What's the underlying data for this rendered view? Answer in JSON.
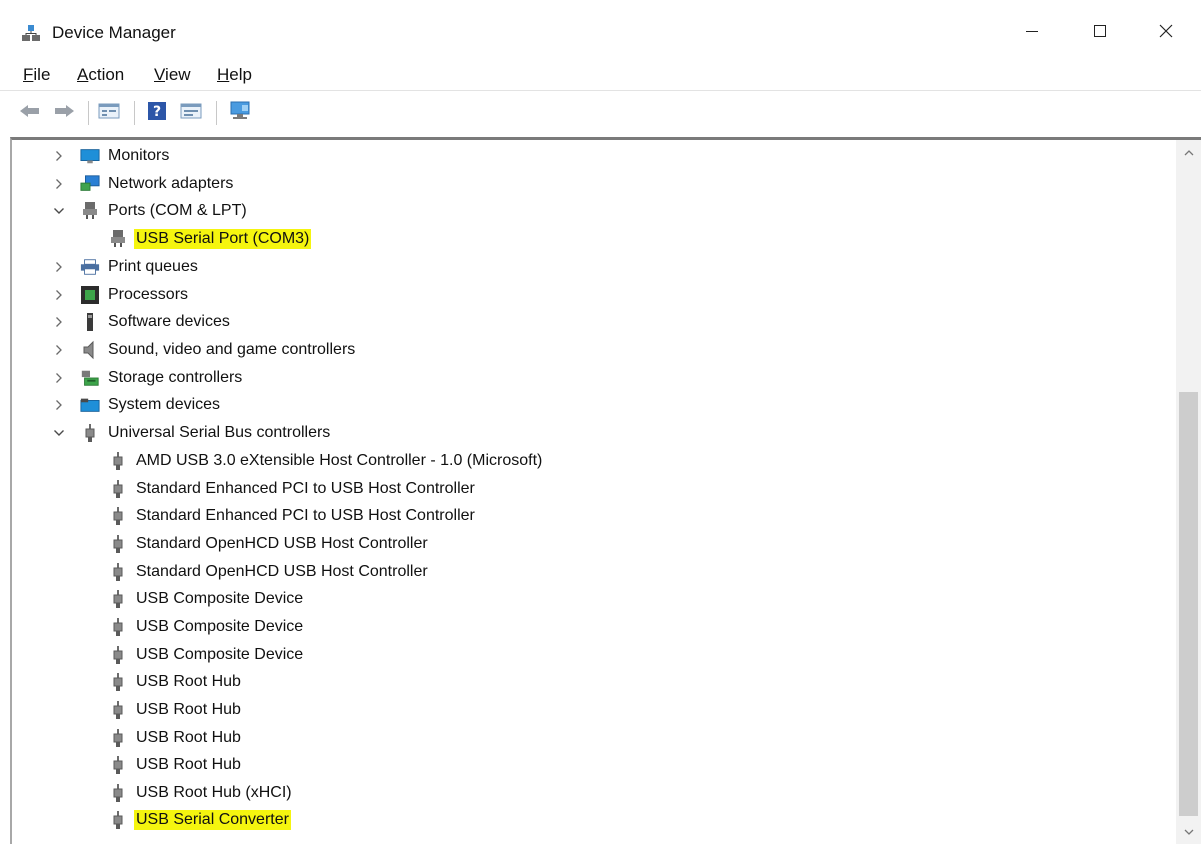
{
  "window": {
    "title": "Device Manager",
    "minimize_label": "—",
    "maximize_label": "☐",
    "close_label": "✕"
  },
  "menu": [
    {
      "key": "F",
      "rest": "ile"
    },
    {
      "key": "A",
      "rest": "ction"
    },
    {
      "key": "V",
      "rest": "iew"
    },
    {
      "key": "H",
      "rest": "elp"
    }
  ],
  "toolbar": {
    "icons": [
      "back-arrow-icon",
      "forward-arrow-icon",
      "properties-icon",
      "help-icon",
      "update-driver-icon",
      "scan-hardware-icon"
    ]
  },
  "colors": {
    "highlight": "#f5f50f",
    "monitor_blue": "#1e8fd8",
    "network_blue": "#2a7fd4",
    "chevron": "#5a5a5a"
  },
  "tree": {
    "categories": [
      {
        "label": "Monitors",
        "expanded": false,
        "icon": "monitor-icon"
      },
      {
        "label": "Network adapters",
        "expanded": false,
        "icon": "network-adapter-icon"
      },
      {
        "label": "Ports (COM & LPT)",
        "expanded": true,
        "icon": "port-icon",
        "children": [
          {
            "label": "USB Serial Port (COM3)",
            "icon": "port-icon",
            "highlighted": true
          }
        ]
      },
      {
        "label": "Print queues",
        "expanded": false,
        "icon": "printer-icon"
      },
      {
        "label": "Processors",
        "expanded": false,
        "icon": "processor-icon"
      },
      {
        "label": "Software devices",
        "expanded": false,
        "icon": "software-device-icon"
      },
      {
        "label": "Sound, video and game controllers",
        "expanded": false,
        "icon": "speaker-icon"
      },
      {
        "label": "Storage controllers",
        "expanded": false,
        "icon": "storage-controller-icon"
      },
      {
        "label": "System devices",
        "expanded": false,
        "icon": "system-device-icon"
      },
      {
        "label": "Universal Serial Bus controllers",
        "expanded": true,
        "icon": "usb-icon",
        "children": [
          {
            "label": "AMD USB 3.0 eXtensible Host Controller - 1.0 (Microsoft)",
            "icon": "usb-icon"
          },
          {
            "label": "Standard Enhanced PCI to USB Host Controller",
            "icon": "usb-icon"
          },
          {
            "label": "Standard Enhanced PCI to USB Host Controller",
            "icon": "usb-icon"
          },
          {
            "label": "Standard OpenHCD USB Host Controller",
            "icon": "usb-icon"
          },
          {
            "label": "Standard OpenHCD USB Host Controller",
            "icon": "usb-icon"
          },
          {
            "label": "USB Composite Device",
            "icon": "usb-icon"
          },
          {
            "label": "USB Composite Device",
            "icon": "usb-icon"
          },
          {
            "label": "USB Composite Device",
            "icon": "usb-icon"
          },
          {
            "label": "USB Root Hub",
            "icon": "usb-icon"
          },
          {
            "label": "USB Root Hub",
            "icon": "usb-icon"
          },
          {
            "label": "USB Root Hub",
            "icon": "usb-icon"
          },
          {
            "label": "USB Root Hub",
            "icon": "usb-icon"
          },
          {
            "label": "USB Root Hub (xHCI)",
            "icon": "usb-icon"
          },
          {
            "label": "USB Serial Converter",
            "icon": "usb-icon",
            "highlighted": true
          }
        ]
      }
    ]
  }
}
